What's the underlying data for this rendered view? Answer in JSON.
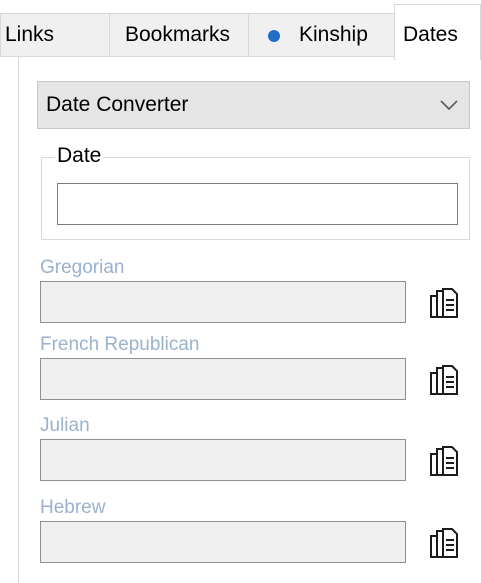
{
  "tabs": [
    {
      "label": "Links",
      "active": false
    },
    {
      "label": "Bookmarks",
      "active": false
    },
    {
      "label": "Kinship",
      "active": false,
      "icon": "blue-dot-icon"
    },
    {
      "label": "Dates",
      "active": true
    }
  ],
  "converter": {
    "selected": "Date Converter",
    "chevron_icon": "chevron-down-icon"
  },
  "date_group": {
    "legend": "Date",
    "value": ""
  },
  "calendars": [
    {
      "label": "Gregorian",
      "value": "",
      "copy_icon": "copy-icon"
    },
    {
      "label": "French Republican",
      "value": "",
      "copy_icon": "copy-icon"
    },
    {
      "label": "Julian",
      "value": "",
      "copy_icon": "copy-icon"
    },
    {
      "label": "Hebrew",
      "value": "",
      "copy_icon": "copy-icon"
    }
  ],
  "colors": {
    "disabled_label": "#9ab2ce",
    "status_dot": "#1f6fc8",
    "dropdown_bg": "#e5e5e5",
    "readonly_field_bg": "#f0f0f0"
  }
}
